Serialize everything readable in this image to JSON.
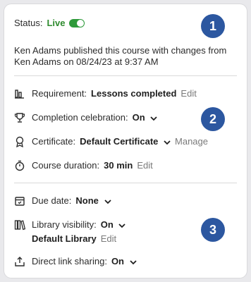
{
  "status": {
    "label": "Status:",
    "value": "Live",
    "toggle_on": true
  },
  "published": {
    "line1": "Ken Adams published this course with changes from",
    "line2": "Ken Adams on 08/24/23 at 9:37 AM"
  },
  "requirement": {
    "label": "Requirement:",
    "value": "Lessons completed",
    "action": "Edit",
    "icon": "bar-chart-icon"
  },
  "completion": {
    "label": "Completion celebration:",
    "value": "On",
    "icon": "trophy-icon"
  },
  "certificate": {
    "label": "Certificate:",
    "value": "Default Certificate",
    "action": "Manage",
    "icon": "ribbon-icon"
  },
  "duration": {
    "label": "Course duration:",
    "value": "30 min",
    "action": "Edit",
    "icon": "stopwatch-icon"
  },
  "due_date": {
    "label": "Due date:",
    "value": "None",
    "icon": "calendar-icon"
  },
  "library": {
    "label": "Library visibility:",
    "value": "On",
    "sub_value": "Default Library",
    "action": "Edit",
    "icon": "books-icon"
  },
  "direct_link": {
    "label": "Direct link sharing:",
    "value": "On",
    "icon": "share-icon"
  },
  "badges": [
    "1",
    "2",
    "3"
  ],
  "colors": {
    "accent": "#2c57a0",
    "live": "#2e8b2e",
    "muted": "#7a7a7a"
  }
}
